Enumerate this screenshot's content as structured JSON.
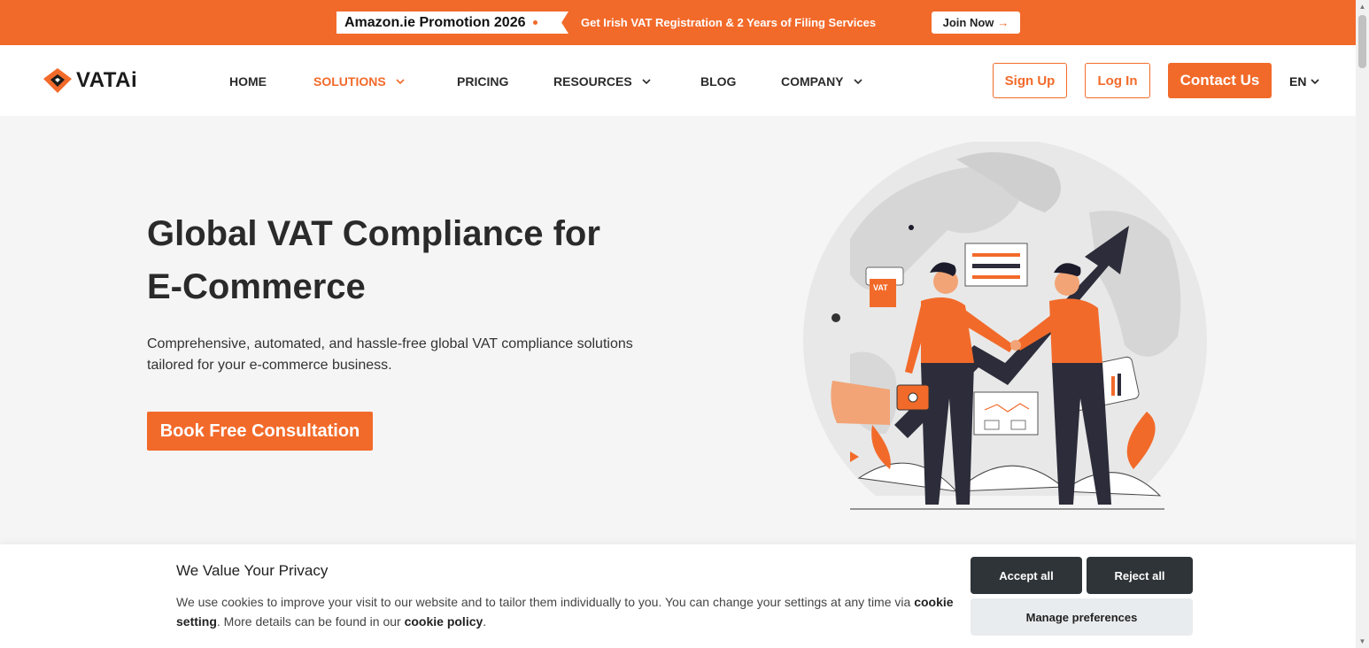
{
  "promo": {
    "tag": "Amazon.ie Promotion 2026",
    "text": "Get Irish VAT Registration & 2 Years of Filing Services",
    "join_label": "Join Now",
    "join_arrow": "→"
  },
  "header": {
    "logo_text": "VATAi",
    "nav": [
      {
        "label": "HOME"
      },
      {
        "label": "SOLUTIONS"
      },
      {
        "label": "PRICING"
      },
      {
        "label": "RESOURCES"
      },
      {
        "label": "BLOG"
      },
      {
        "label": "COMPANY"
      }
    ],
    "signup_label": "Sign Up",
    "login_label": "Log In",
    "contact_label": "Contact Us",
    "lang_label": "EN"
  },
  "hero": {
    "title_line1": "Global VAT Compliance for",
    "title_line2": "E-Commerce",
    "subtitle_line1": "Comprehensive, automated, and hassle-free global VAT compliance solutions",
    "subtitle_line2": "tailored for your e-commerce business.",
    "cta_label": "Book Free Consultation",
    "illustration_vat_label": "VAT"
  },
  "cookie": {
    "title": "We Value Your Privacy",
    "text_part1": "We use cookies to improve your visit to our website and to tailor them individually to you. You can change your settings at any time via ",
    "link1": "cookie setting",
    "text_part2": ". More details can be found in our ",
    "link2": "cookie policy",
    "text_part3": ".",
    "accept_label": "Accept all",
    "reject_label": "Reject all",
    "manage_label": "Manage preferences"
  },
  "colors": {
    "accent": "#f26a2a",
    "dark_button": "#2f3438",
    "background": "#f5f5f5"
  }
}
